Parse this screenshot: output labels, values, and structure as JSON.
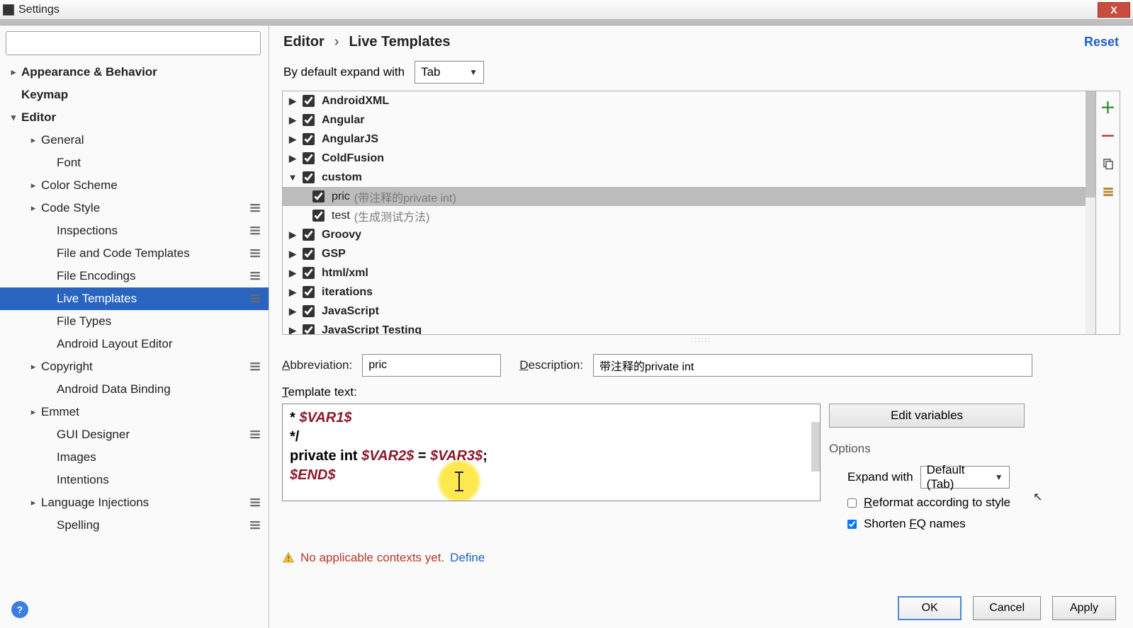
{
  "window": {
    "title": "Settings",
    "close": "X"
  },
  "sidebar": {
    "search_placeholder": "",
    "items": [
      {
        "label": "Appearance & Behavior",
        "bold": true,
        "chev": "▸",
        "indent": 1
      },
      {
        "label": "Keymap",
        "bold": true,
        "indent": 1
      },
      {
        "label": "Editor",
        "bold": true,
        "chev": "▾",
        "indent": 1
      },
      {
        "label": "General",
        "chev": "▸",
        "indent": 2
      },
      {
        "label": "Font",
        "indent": 3
      },
      {
        "label": "Color Scheme",
        "chev": "▸",
        "indent": 2
      },
      {
        "label": "Code Style",
        "chev": "▸",
        "indent": 2,
        "cfg": true
      },
      {
        "label": "Inspections",
        "indent": 3,
        "cfg": true
      },
      {
        "label": "File and Code Templates",
        "indent": 3,
        "cfg": true
      },
      {
        "label": "File Encodings",
        "indent": 3,
        "cfg": true
      },
      {
        "label": "Live Templates",
        "indent": 3,
        "cfg": true,
        "selected": true
      },
      {
        "label": "File Types",
        "indent": 3
      },
      {
        "label": "Android Layout Editor",
        "indent": 3
      },
      {
        "label": "Copyright",
        "chev": "▸",
        "indent": 2,
        "cfg": true
      },
      {
        "label": "Android Data Binding",
        "indent": 3
      },
      {
        "label": "Emmet",
        "chev": "▸",
        "indent": 2
      },
      {
        "label": "GUI Designer",
        "indent": 3,
        "cfg": true
      },
      {
        "label": "Images",
        "indent": 3
      },
      {
        "label": "Intentions",
        "indent": 3
      },
      {
        "label": "Language Injections",
        "chev": "▸",
        "indent": 2,
        "cfg": true
      },
      {
        "label": "Spelling",
        "indent": 3,
        "cfg": true
      }
    ]
  },
  "breadcrumb": {
    "a": "Editor",
    "sep": "›",
    "b": "Live Templates",
    "reset": "Reset"
  },
  "expand": {
    "label": "By default expand with",
    "value": "Tab"
  },
  "templates": {
    "groups": [
      {
        "label": "AndroidXML",
        "expanded": false,
        "bold": true
      },
      {
        "label": "Angular",
        "expanded": false,
        "bold": true
      },
      {
        "label": "AngularJS",
        "expanded": false,
        "bold": true
      },
      {
        "label": "ColdFusion",
        "expanded": false,
        "bold": true
      },
      {
        "label": "custom",
        "expanded": true,
        "bold": true,
        "children": [
          {
            "label": "pric",
            "desc": "(带注释的private int)",
            "selected": true
          },
          {
            "label": "test",
            "desc": "(生成测试方法)"
          }
        ]
      },
      {
        "label": "Groovy",
        "expanded": false,
        "bold": true
      },
      {
        "label": "GSP",
        "expanded": false,
        "bold": true
      },
      {
        "label": "html/xml",
        "expanded": false,
        "bold": true
      },
      {
        "label": "iterations",
        "expanded": false,
        "bold": true
      },
      {
        "label": "JavaScript",
        "expanded": false,
        "bold": true
      },
      {
        "label": "JavaScript Testing",
        "expanded": false,
        "bold": true
      }
    ]
  },
  "form": {
    "abbrev_label": "Abbreviation:",
    "abbrev_value": "pric",
    "desc_label": "Description:",
    "desc_value": "带注释的private int",
    "template_label": "Template text:",
    "edit_vars": "Edit variables"
  },
  "code": {
    "line1_prefix": " * ",
    "line1_var": "$VAR1$",
    "line2": " */",
    "line3_a": "private int ",
    "line3_var2": "$VAR2$",
    "line3_eq": " = ",
    "line3_var3": "$VAR3$",
    "line3_end": ";",
    "line4_var": "$END$"
  },
  "options": {
    "title": "Options",
    "expand_label": "Expand with",
    "expand_value": "Default (Tab)",
    "reformat": "Reformat according to style",
    "shorten": "Shorten FQ names"
  },
  "warn": {
    "text": "No applicable contexts yet. ",
    "link": "Define"
  },
  "footer": {
    "ok": "OK",
    "cancel": "Cancel",
    "apply": "Apply",
    "help": "?"
  },
  "grip": "::::::"
}
